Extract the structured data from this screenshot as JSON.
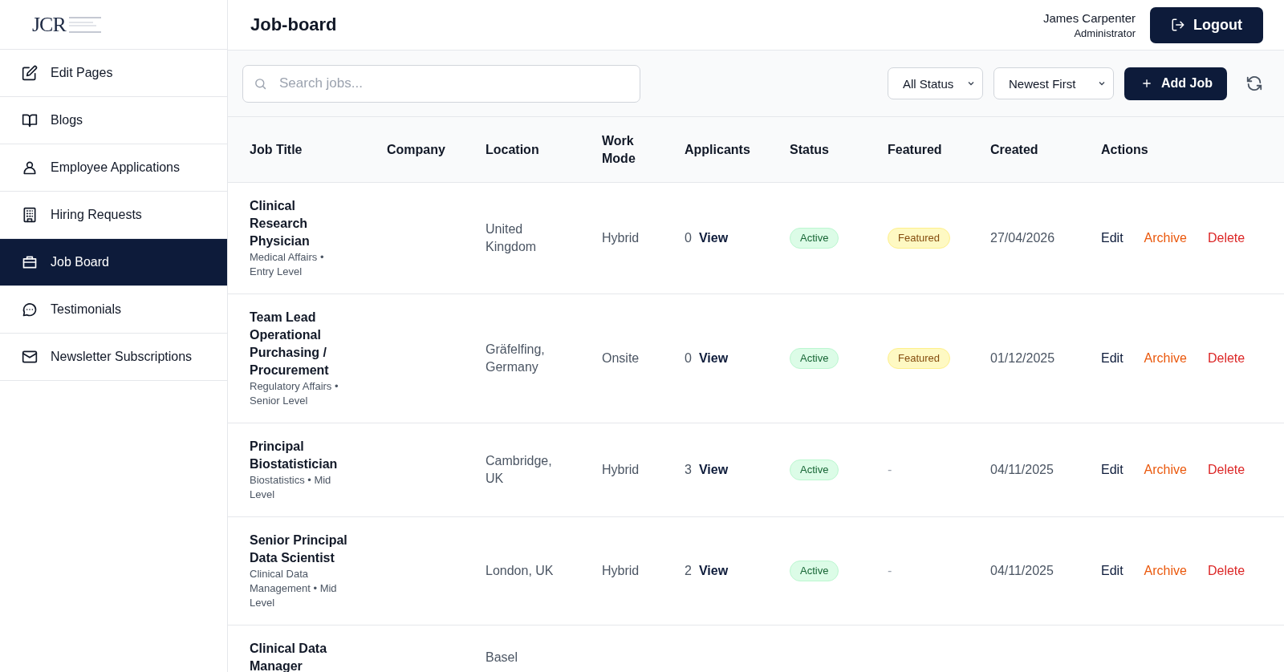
{
  "logo": {
    "text": "JCR"
  },
  "sidebar": {
    "items": [
      {
        "label": "Edit Pages",
        "selected": false
      },
      {
        "label": "Blogs",
        "selected": false
      },
      {
        "label": "Employee Applications",
        "selected": false
      },
      {
        "label": "Hiring Requests",
        "selected": false
      },
      {
        "label": "Job Board",
        "selected": true
      },
      {
        "label": "Testimonials",
        "selected": false
      },
      {
        "label": "Newsletter Subscriptions",
        "selected": false
      }
    ]
  },
  "header": {
    "title": "Job-board",
    "user_name": "James Carpenter",
    "user_role": "Administrator",
    "logout": "Logout"
  },
  "toolbar": {
    "search_placeholder": "Search jobs...",
    "status_filter": "All Status",
    "sort": "Newest First",
    "add_button": "Add Job"
  },
  "table": {
    "columns": [
      "Job Title",
      "Company",
      "Location",
      "Work Mode",
      "Applicants",
      "Status",
      "Featured",
      "Created",
      "Actions"
    ],
    "rows": [
      {
        "title": "Clinical Research Physician",
        "subtitle": "Medical Affairs • Entry Level",
        "location": "United Kingdom",
        "work_mode": "Hybrid",
        "applicants": "0",
        "view": "View",
        "status": "Active",
        "featured": true,
        "featured_label": "Featured",
        "created": "27/04/2026",
        "actions": [
          {
            "label": "Edit",
            "kind": "edit"
          },
          {
            "label": "Archive",
            "kind": "archive"
          },
          {
            "label": "Delete",
            "kind": "delete"
          }
        ]
      },
      {
        "title": "Team Lead Operational Purchasing / Procurement",
        "subtitle": "Regulatory Affairs • Senior Level",
        "location": "Gräfelfing, Germany",
        "work_mode": "Onsite",
        "applicants": "0",
        "view": "View",
        "status": "Active",
        "featured": true,
        "featured_label": "Featured",
        "created": "01/12/2025",
        "actions": [
          {
            "label": "Edit",
            "kind": "edit"
          },
          {
            "label": "Archive",
            "kind": "archive"
          },
          {
            "label": "Delete",
            "kind": "delete"
          }
        ]
      },
      {
        "title": "Principal Biostatistician",
        "subtitle": "Biostatistics • Mid Level",
        "location": "Cambridge, UK",
        "work_mode": "Hybrid",
        "applicants": "3",
        "view": "View",
        "status": "Active",
        "featured": false,
        "featured_label": "-",
        "created": "04/11/2025",
        "actions": [
          {
            "label": "Edit",
            "kind": "edit"
          },
          {
            "label": "Archive",
            "kind": "archive"
          },
          {
            "label": "Delete",
            "kind": "delete"
          }
        ]
      },
      {
        "title": "Senior Principal Data Scientist",
        "subtitle": "Clinical Data Management • Mid Level",
        "location": "London, UK",
        "work_mode": "Hybrid",
        "applicants": "2",
        "view": "View",
        "status": "Active",
        "featured": false,
        "featured_label": "-",
        "created": "04/11/2025",
        "actions": [
          {
            "label": "Edit",
            "kind": "edit"
          },
          {
            "label": "Archive",
            "kind": "archive"
          },
          {
            "label": "Delete",
            "kind": "delete"
          }
        ]
      },
      {
        "title": "Clinical Data Manager",
        "location": "Basel"
      }
    ]
  }
}
